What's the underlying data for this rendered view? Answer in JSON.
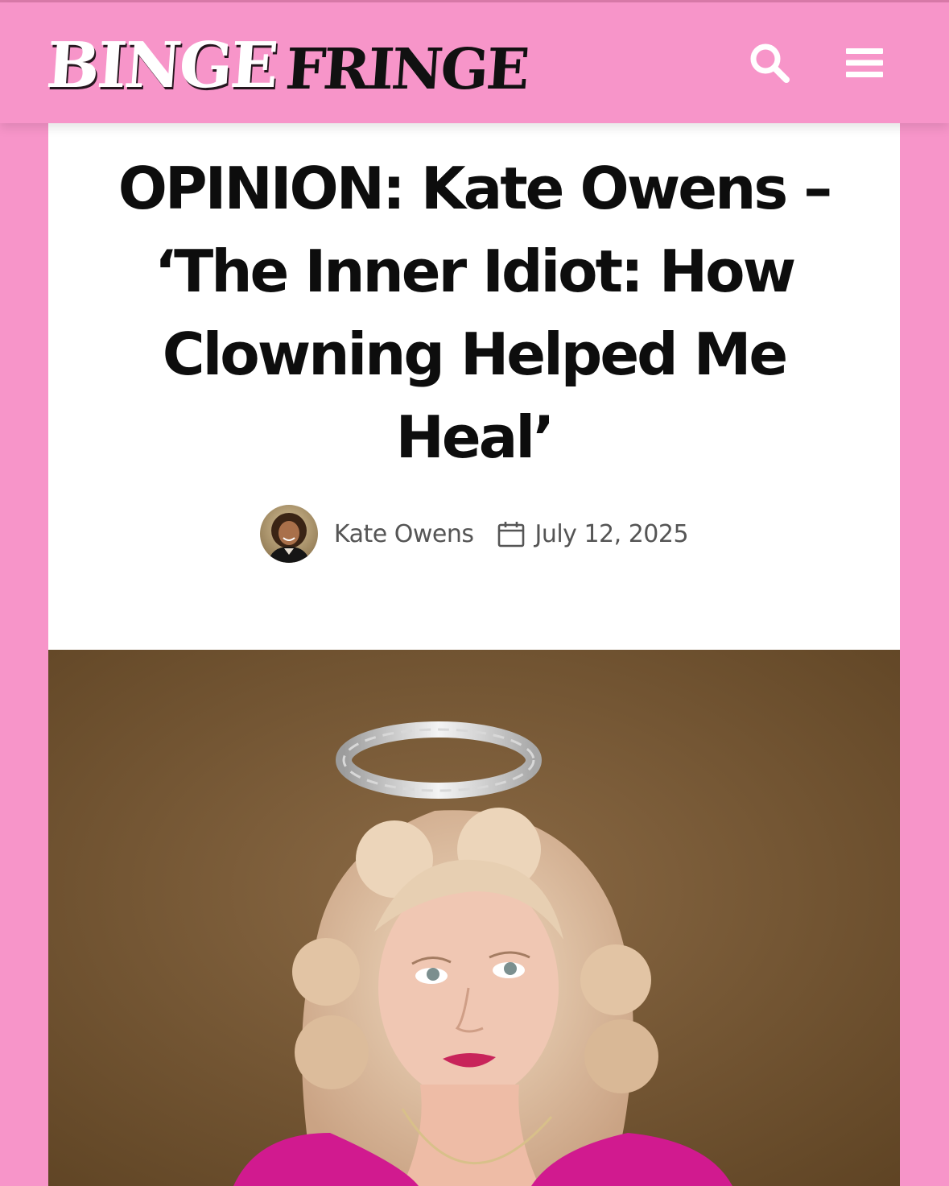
{
  "site": {
    "brand_word_1": "BINGE",
    "brand_word_2": "FRINGE",
    "colors": {
      "header_bg": "#f795c9",
      "card_bg": "#ffffff",
      "headline": "#0d0d0d",
      "meta_text": "#555555"
    }
  },
  "header": {
    "search_icon": "search-icon",
    "menu_icon": "hamburger-menu-icon"
  },
  "article": {
    "headline": "OPINION: Kate Owens – ‘The Inner Idiot: How Clowning Helped Me Heal’",
    "author": "Kate Owens",
    "date": "July 12, 2025",
    "date_icon": "calendar-icon"
  }
}
